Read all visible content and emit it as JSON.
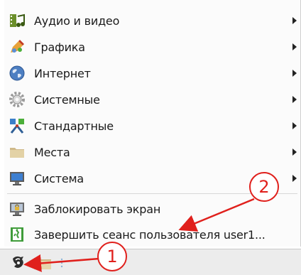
{
  "menu": {
    "items": [
      {
        "label": "Аудио и видео",
        "icon": "multimedia-icon",
        "submenu": true
      },
      {
        "label": "Графика",
        "icon": "graphics-icon",
        "submenu": true
      },
      {
        "label": "Интернет",
        "icon": "internet-globe-icon",
        "submenu": true
      },
      {
        "label": "Системные",
        "icon": "system-gear-icon",
        "submenu": true
      },
      {
        "label": "Стандартные",
        "icon": "accessories-icon",
        "submenu": true
      },
      {
        "label": "Места",
        "icon": "folder-icon",
        "submenu": true
      },
      {
        "label": "Система",
        "icon": "monitor-icon",
        "submenu": true
      },
      {
        "label": "Заблокировать экран",
        "icon": "lock-screen-icon",
        "submenu": false
      },
      {
        "label": "Завершить сеанс пользователя user1...",
        "icon": "logout-icon",
        "submenu": false
      }
    ]
  },
  "panel": {
    "start_icon": "start-menu-icon",
    "folder_icon": "file-manager-icon",
    "separator_icon": "panel-separator-icon"
  },
  "annotations": {
    "callout_1": "1",
    "callout_2": "2",
    "color": "#e0201c"
  }
}
